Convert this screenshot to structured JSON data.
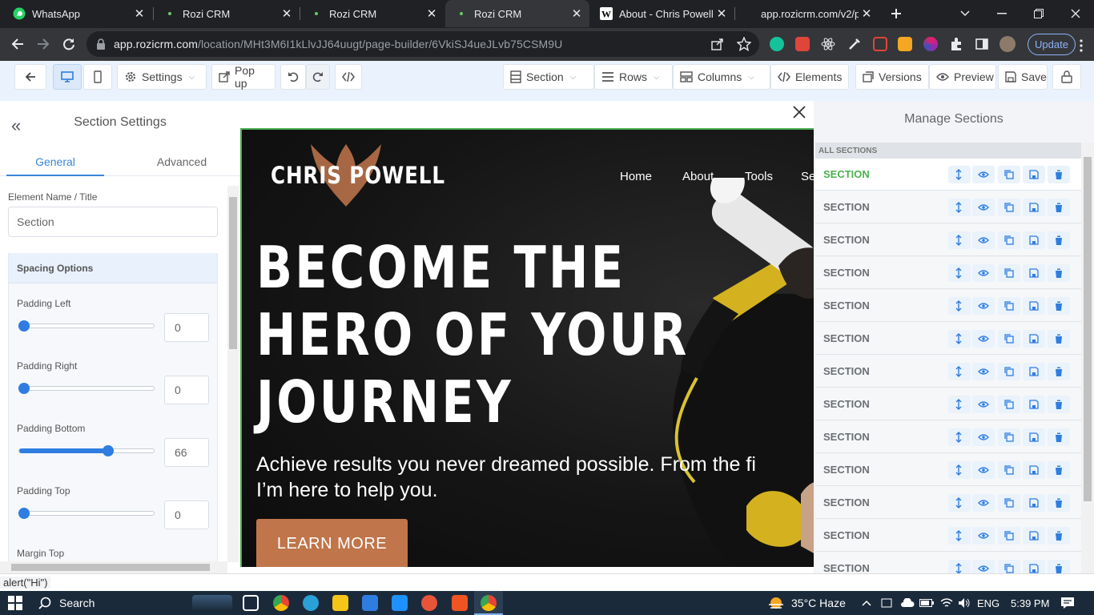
{
  "browser": {
    "tabs": [
      {
        "title": "WhatsApp",
        "favicon": "whatsapp-icon",
        "active": false
      },
      {
        "title": "Rozi CRM",
        "favicon": "rozi-icon",
        "active": false
      },
      {
        "title": "Rozi CRM",
        "favicon": "rozi-icon",
        "active": false
      },
      {
        "title": "Rozi CRM",
        "favicon": "rozi-icon",
        "active": true
      },
      {
        "title": "About - Chris Powell",
        "favicon": "w-icon",
        "active": false
      },
      {
        "title": "app.rozicrm.com/v2/p",
        "favicon": "",
        "active": false
      }
    ],
    "url_host": "app.rozicrm.com",
    "url_path": "/location/MHt3M6I1kLlvJJ64uugt/page-builder/6VkiSJ4ueJLvb75CSM9U",
    "update_label": "Update",
    "status_text": "alert(\"Hi\")"
  },
  "builder_toolbar": {
    "settings_label": "Settings",
    "popup_label": "Pop up",
    "section_label": "Section",
    "rows_label": "Rows",
    "columns_label": "Columns",
    "elements_label": "Elements",
    "versions_label": "Versions",
    "preview_label": "Preview",
    "save_label": "Save"
  },
  "left_panel": {
    "title": "Section Settings",
    "tab_general": "General",
    "tab_advanced": "Advanced",
    "element_name_label": "Element Name / Title",
    "element_name_value": "Section",
    "spacing_title": "Spacing Options",
    "padding_left_label": "Padding Left",
    "padding_left_value": "0",
    "padding_right_label": "Padding Right",
    "padding_right_value": "0",
    "padding_bottom_label": "Padding Bottom",
    "padding_bottom_value": "66",
    "padding_top_label": "Padding Top",
    "padding_top_value": "0",
    "margin_top_label": "Margin Top"
  },
  "hero": {
    "logo_text": "CHRIS POWELL",
    "nav": [
      "Home",
      "About",
      "Tools",
      "Se"
    ],
    "headline_lines": [
      "BECOME THE",
      "HERO OF YOUR",
      "JOURNEY"
    ],
    "subtext_line1": "Achieve results you never dreamed possible. From the fi",
    "subtext_line2": "I’m here to help you.",
    "cta_label": "LEARN MORE",
    "accent_color": "#c0754a"
  },
  "right_panel": {
    "title": "Manage Sections",
    "all_sections_label": "ALL SECTIONS",
    "sections": [
      "SECTION",
      "SECTION",
      "SECTION",
      "SECTION",
      "SECTION",
      "SECTION",
      "SECTION",
      "SECTION",
      "SECTION",
      "SECTION",
      "SECTION",
      "SECTION",
      "SECTION"
    ]
  },
  "taskbar": {
    "search_label": "Search",
    "weather": "35°C  Haze",
    "language": "ENG",
    "time": "5:39 PM"
  }
}
